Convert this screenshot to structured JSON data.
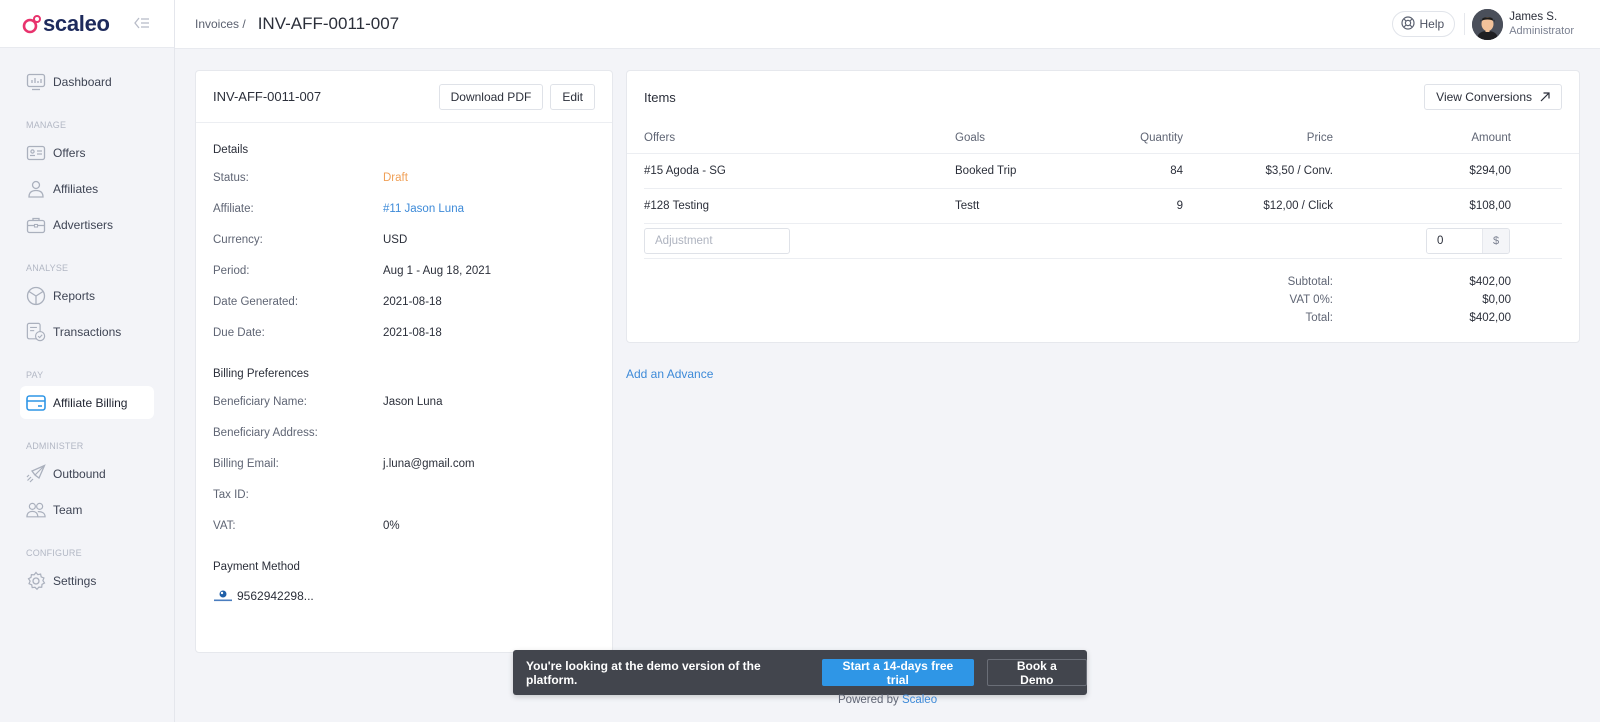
{
  "app": {
    "brand": "scaleo",
    "brand_color": "#e8336d",
    "accent_color": "#2f96e6"
  },
  "sidebar": {
    "items": [
      {
        "label": "Dashboard",
        "icon": "dashboard-icon"
      },
      {
        "section": "MANAGE"
      },
      {
        "label": "Offers",
        "icon": "offers-icon"
      },
      {
        "label": "Affiliates",
        "icon": "user-icon"
      },
      {
        "label": "Advertisers",
        "icon": "briefcase-icon"
      },
      {
        "section": "ANALYSE"
      },
      {
        "label": "Reports",
        "icon": "reports-icon"
      },
      {
        "label": "Transactions",
        "icon": "transactions-icon"
      },
      {
        "section": "PAY"
      },
      {
        "label": "Affiliate Billing",
        "icon": "credit-card-icon",
        "active": true
      },
      {
        "section": "ADMINISTER"
      },
      {
        "label": "Outbound",
        "icon": "paper-plane-icon"
      },
      {
        "label": "Team",
        "icon": "team-icon"
      },
      {
        "section": "CONFIGURE"
      },
      {
        "label": "Settings",
        "icon": "gear-icon"
      }
    ]
  },
  "header": {
    "breadcrumb": "Invoices /",
    "title": "INV-AFF-0011-007",
    "help_label": "Help",
    "user_name": "James S.",
    "user_role": "Administrator"
  },
  "invoice": {
    "title": "INV-AFF-0011-007",
    "download_label": "Download PDF",
    "edit_label": "Edit",
    "details_title": "Details",
    "details": [
      {
        "label": "Status:",
        "value": "Draft"
      },
      {
        "label": "Affiliate:",
        "value": "#11 Jason Luna"
      },
      {
        "label": "Currency:",
        "value": "USD"
      },
      {
        "label": "Period:",
        "value": "Aug 1 - Aug 18, 2021"
      },
      {
        "label": "Date Generated:",
        "value": "2021-08-18"
      },
      {
        "label": "Due Date:",
        "value": "2021-08-18"
      }
    ],
    "billing_title": "Billing Preferences",
    "billing": [
      {
        "label": "Beneficiary Name:",
        "value": "Jason Luna"
      },
      {
        "label": "Beneficiary Address:",
        "value": ""
      },
      {
        "label": "Billing Email:",
        "value": "j.luna@gmail.com"
      },
      {
        "label": "Tax ID:",
        "value": ""
      },
      {
        "label": "VAT:",
        "value": "0%"
      }
    ],
    "payment_title": "Payment Method",
    "payment_value": "9562942298..."
  },
  "items": {
    "title": "Items",
    "view_conversions_label": "View Conversions",
    "columns": [
      "Offers",
      "Goals",
      "Quantity",
      "Price",
      "Amount"
    ],
    "rows": [
      {
        "offer": "#15  Agoda - SG",
        "goal": "Booked Trip",
        "quantity": "84",
        "price": "$3,50 / Conv.",
        "amount": "$294,00"
      },
      {
        "offer": "#128  Testing",
        "goal": "Testt",
        "quantity": "9",
        "price": "$12,00 / Click",
        "amount": "$108,00"
      }
    ],
    "adjustment_placeholder": "Adjustment",
    "adjustment_amount": "0",
    "currency_symbol": "$",
    "totals": [
      {
        "label": "Subtotal:",
        "value": "$402,00"
      },
      {
        "label": "VAT 0%:",
        "value": "$0,00"
      },
      {
        "label": "Total:",
        "value": "$402,00"
      }
    ],
    "add_advance_label": "Add an Advance"
  },
  "banner": {
    "text": "You're looking at the demo version of the platform.",
    "trial_label": "Start a 14-days free trial",
    "demo_label": "Book a Demo"
  },
  "footer": {
    "powered_by": "Powered by",
    "powered_link": "Scaleo"
  }
}
